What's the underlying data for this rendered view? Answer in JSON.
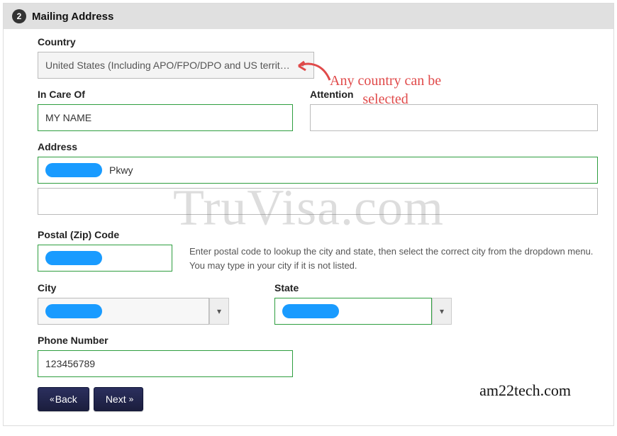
{
  "step": {
    "number": "2",
    "title": "Mailing Address"
  },
  "country": {
    "label": "Country",
    "value": "United States (Including APO/FPO/DPO and US territo..."
  },
  "inCareOf": {
    "label": "In Care Of",
    "value": "MY NAME"
  },
  "attention": {
    "label": "Attention",
    "value": ""
  },
  "address": {
    "label": "Address",
    "line1_suffix": "Pkwy",
    "line2": ""
  },
  "postal": {
    "label": "Postal (Zip) Code",
    "help": "Enter postal code to lookup the city and state, then select the correct city from the dropdown menu. You may type in your city if it is not listed."
  },
  "city": {
    "label": "City"
  },
  "state": {
    "label": "State"
  },
  "phone": {
    "label": "Phone Number",
    "value": "123456789"
  },
  "nav": {
    "back": "Back",
    "next": "Next"
  },
  "annotation": {
    "line1": "Any country can be",
    "line2": "selected"
  },
  "watermark": "TruVisa.com",
  "footer": "am22tech.com"
}
